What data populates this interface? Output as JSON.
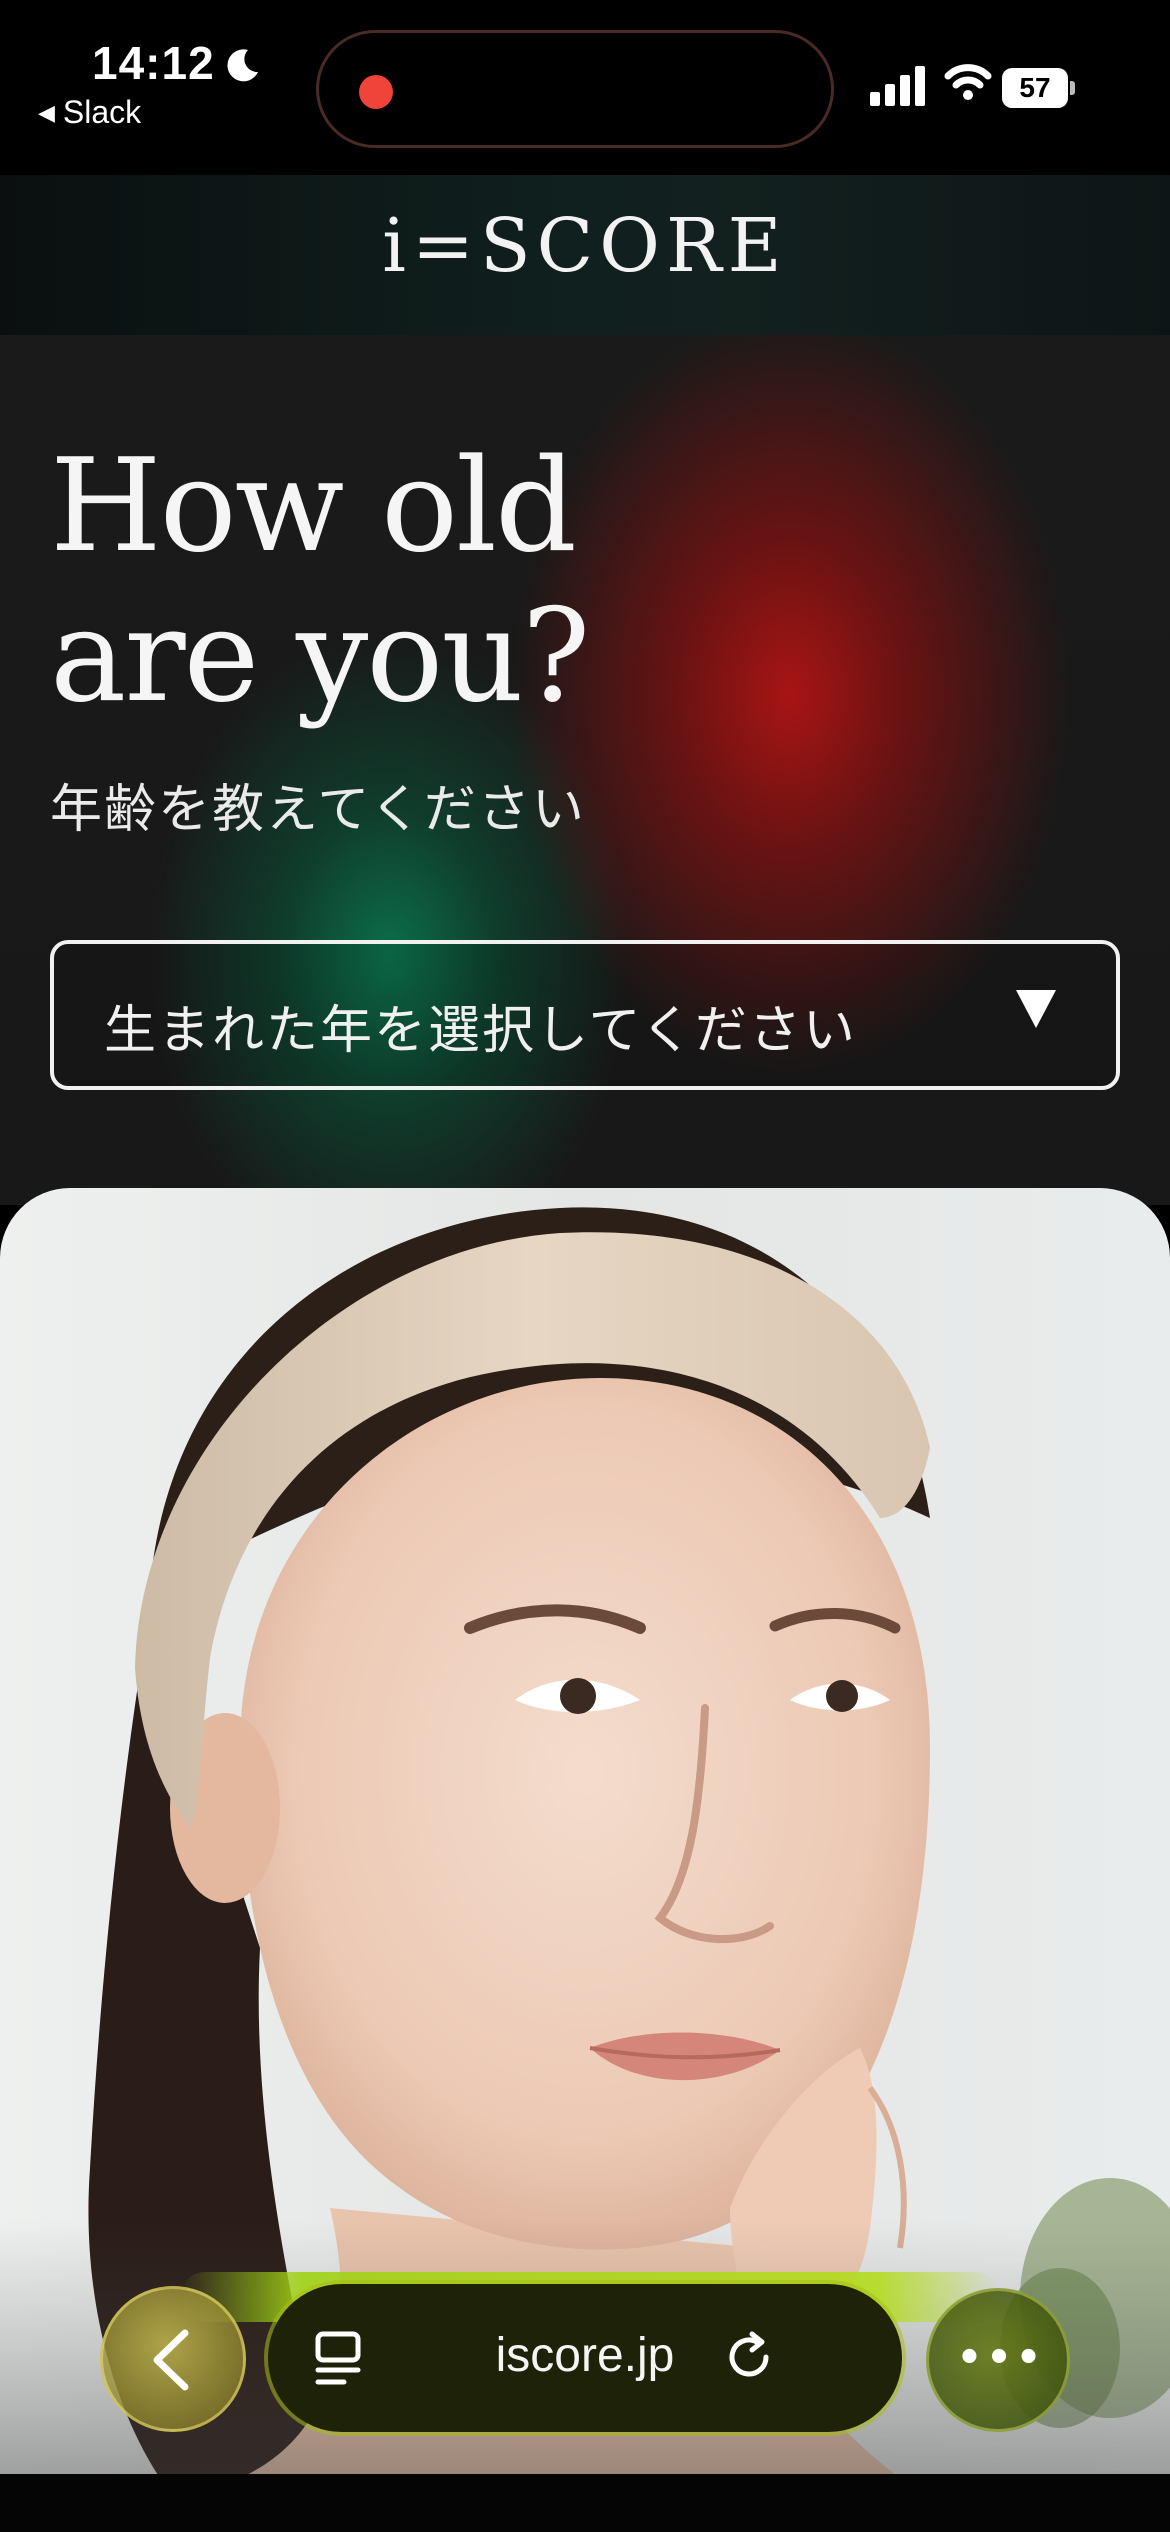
{
  "status_bar": {
    "time": "14:12",
    "back_app": "Slack",
    "battery": "57",
    "icons": [
      "moon-icon",
      "signal-icon",
      "wifi-icon",
      "battery-icon"
    ]
  },
  "brand": {
    "logo_text": "i=SCORE"
  },
  "hero": {
    "question_line1": "How old",
    "question_line2": "are you?",
    "subtitle_ja": "年齢を教えてください",
    "select": {
      "placeholder": "生まれた年を選択してください",
      "arrow": "▼"
    },
    "colors": {
      "red": "#b01414",
      "green": "#0a7850"
    }
  },
  "browser_bar": {
    "url": "iscore.jp",
    "more": "•••",
    "accent": "#a8c814"
  }
}
